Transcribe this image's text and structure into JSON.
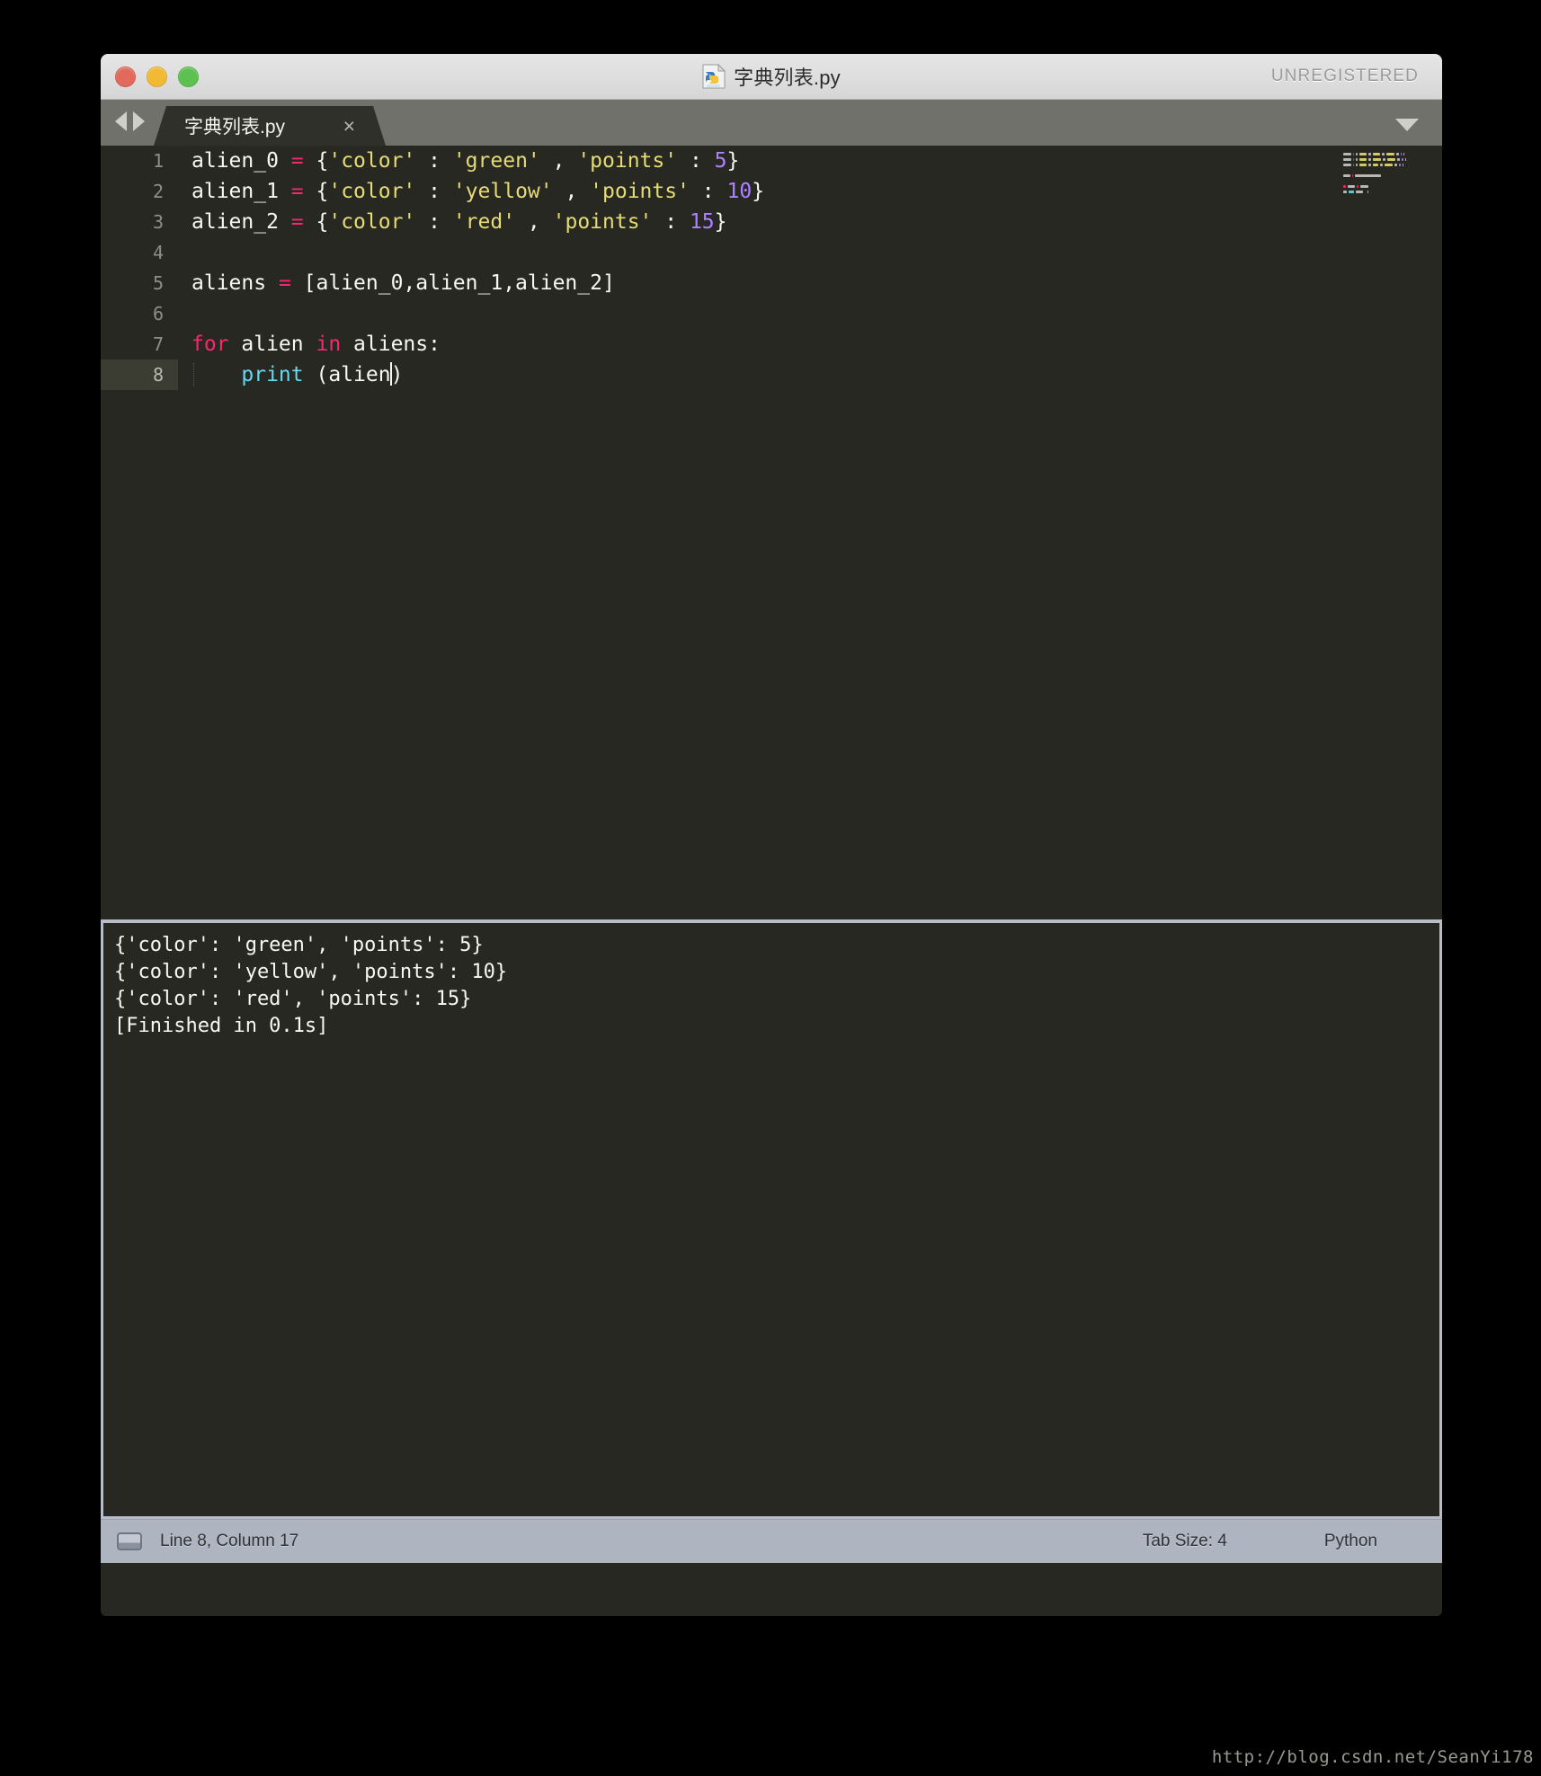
{
  "window": {
    "title": "字典列表.py",
    "title_icon": "python-file-icon",
    "unregistered_label": "UNREGISTERED",
    "traffic_lights": [
      {
        "name": "close-button",
        "color": "#e2695c"
      },
      {
        "name": "minimize-button",
        "color": "#f2b935"
      },
      {
        "name": "maximize-button",
        "color": "#5cc151"
      }
    ]
  },
  "tabbar": {
    "nav_back_icon": "arrow-left-icon",
    "nav_forward_icon": "arrow-right-icon",
    "tab_label": "字典列表.py",
    "tab_close_icon": "×",
    "menu_icon": "chevron-down-icon"
  },
  "editor": {
    "background": "#272822",
    "active_line": 8,
    "gutter_numbers": [
      "1",
      "2",
      "3",
      "4",
      "5",
      "6",
      "7",
      "8"
    ],
    "lines": [
      {
        "number": "1",
        "tokens": [
          {
            "t": "alien_0 ",
            "c": "plain"
          },
          {
            "t": "=",
            "c": "op"
          },
          {
            "t": " {",
            "c": "plain"
          },
          {
            "t": "'color'",
            "c": "str"
          },
          {
            "t": " : ",
            "c": "plain"
          },
          {
            "t": "'green'",
            "c": "str"
          },
          {
            "t": " , ",
            "c": "plain"
          },
          {
            "t": "'points'",
            "c": "str"
          },
          {
            "t": " : ",
            "c": "plain"
          },
          {
            "t": "5",
            "c": "num"
          },
          {
            "t": "}",
            "c": "plain"
          }
        ]
      },
      {
        "number": "2",
        "tokens": [
          {
            "t": "alien_1 ",
            "c": "plain"
          },
          {
            "t": "=",
            "c": "op"
          },
          {
            "t": " {",
            "c": "plain"
          },
          {
            "t": "'color'",
            "c": "str"
          },
          {
            "t": " : ",
            "c": "plain"
          },
          {
            "t": "'yellow'",
            "c": "str"
          },
          {
            "t": " , ",
            "c": "plain"
          },
          {
            "t": "'points'",
            "c": "str"
          },
          {
            "t": " : ",
            "c": "plain"
          },
          {
            "t": "10",
            "c": "num"
          },
          {
            "t": "}",
            "c": "plain"
          }
        ]
      },
      {
        "number": "3",
        "tokens": [
          {
            "t": "alien_2 ",
            "c": "plain"
          },
          {
            "t": "=",
            "c": "op"
          },
          {
            "t": " {",
            "c": "plain"
          },
          {
            "t": "'color'",
            "c": "str"
          },
          {
            "t": " : ",
            "c": "plain"
          },
          {
            "t": "'red'",
            "c": "str"
          },
          {
            "t": " , ",
            "c": "plain"
          },
          {
            "t": "'points'",
            "c": "str"
          },
          {
            "t": " : ",
            "c": "plain"
          },
          {
            "t": "15",
            "c": "num"
          },
          {
            "t": "}",
            "c": "plain"
          }
        ]
      },
      {
        "number": "4",
        "tokens": []
      },
      {
        "number": "5",
        "tokens": [
          {
            "t": "aliens ",
            "c": "plain"
          },
          {
            "t": "=",
            "c": "op"
          },
          {
            "t": " [alien_0,alien_1,alien_2]",
            "c": "plain"
          }
        ]
      },
      {
        "number": "6",
        "tokens": []
      },
      {
        "number": "7",
        "tokens": [
          {
            "t": "for",
            "c": "kw"
          },
          {
            "t": " alien ",
            "c": "plain"
          },
          {
            "t": "in",
            "c": "kw"
          },
          {
            "t": " aliens:",
            "c": "plain"
          }
        ]
      },
      {
        "number": "8",
        "tokens": [
          {
            "t": "    ",
            "c": "plain"
          },
          {
            "t": "print",
            "c": "fn"
          },
          {
            "t": " (alien",
            "c": "plain"
          },
          {
            "t": "|CURSOR|",
            "c": "cursor"
          },
          {
            "t": ")",
            "c": "plain"
          }
        ]
      }
    ],
    "syntax_colors": {
      "plain": "#f8f8f2",
      "operator": "#f92672",
      "keyword": "#f92672",
      "string": "#e6db74",
      "number": "#ae81ff",
      "function": "#66d9ef"
    }
  },
  "console": {
    "lines": [
      "{'color': 'green', 'points': 5}",
      "{'color': 'yellow', 'points': 10}",
      "{'color': 'red', 'points': 15}",
      "[Finished in 0.1s]"
    ]
  },
  "statusbar": {
    "console_toggle_icon": "console-panel-icon",
    "position": "Line 8, Column 17",
    "tab_size": "Tab Size: 4",
    "language": "Python"
  },
  "watermark": {
    "text": "http://blog.csdn.net/SeanYi178"
  }
}
